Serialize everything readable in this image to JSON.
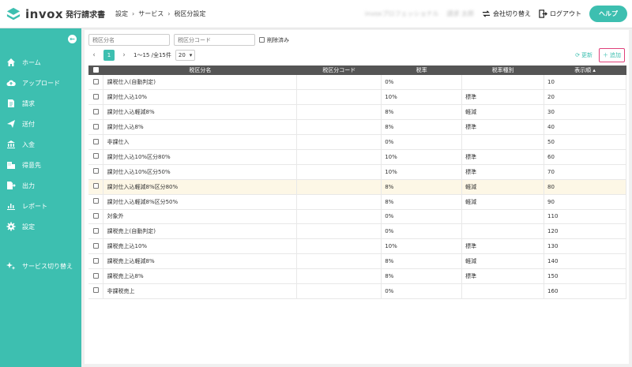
{
  "app": {
    "name": "invox",
    "product": "発行請求書"
  },
  "breadcrumb": [
    "設定",
    "サービス",
    "税区分設定"
  ],
  "header": {
    "company_blurred": "invoxプロフェッショナル",
    "user_blurred": "請求 太郎",
    "switch_company": "会社切り替え",
    "logout": "ログアウト",
    "help": "ヘルプ"
  },
  "sidebar": {
    "items": [
      {
        "label": "ホーム",
        "icon": "home-icon"
      },
      {
        "label": "アップロード",
        "icon": "cloud-upload-icon"
      },
      {
        "label": "請求",
        "icon": "document-icon"
      },
      {
        "label": "送付",
        "icon": "send-icon"
      },
      {
        "label": "入金",
        "icon": "bank-icon"
      },
      {
        "label": "得意先",
        "icon": "building-icon"
      },
      {
        "label": "出力",
        "icon": "export-icon"
      },
      {
        "label": "レポート",
        "icon": "chart-icon"
      },
      {
        "label": "設定",
        "icon": "gear-icon"
      }
    ],
    "switch_service": "サービス切り替え"
  },
  "filters": {
    "name_placeholder": "税区分名",
    "code_placeholder": "税区分コード",
    "show_deleted": "削除済み"
  },
  "pager": {
    "current": "1",
    "range": "1〜15 /全15件",
    "per_page": "20"
  },
  "actions": {
    "refresh": "更新",
    "add": "追加"
  },
  "table": {
    "columns": [
      "税区分名",
      "税区分コード",
      "税率",
      "税率種別",
      "表示順 ▴"
    ],
    "rows": [
      {
        "name": "課税仕入(自動判定)",
        "code": "",
        "rate": "0%",
        "type": "",
        "order": "10"
      },
      {
        "name": "課対仕入込10%",
        "code": "",
        "rate": "10%",
        "type": "標準",
        "order": "20"
      },
      {
        "name": "課対仕入込軽減8%",
        "code": "",
        "rate": "8%",
        "type": "軽減",
        "order": "30"
      },
      {
        "name": "課対仕入込8%",
        "code": "",
        "rate": "8%",
        "type": "標準",
        "order": "40"
      },
      {
        "name": "非課仕入",
        "code": "",
        "rate": "0%",
        "type": "",
        "order": "50"
      },
      {
        "name": "課対仕入込10%区分80%",
        "code": "",
        "rate": "10%",
        "type": "標準",
        "order": "60"
      },
      {
        "name": "課対仕入込10%区分50%",
        "code": "",
        "rate": "10%",
        "type": "標準",
        "order": "70"
      },
      {
        "name": "課対仕入込軽減8%区分80%",
        "code": "",
        "rate": "8%",
        "type": "軽減",
        "order": "80"
      },
      {
        "name": "課対仕入込軽減8%区分50%",
        "code": "",
        "rate": "8%",
        "type": "軽減",
        "order": "90"
      },
      {
        "name": "対象外",
        "code": "",
        "rate": "0%",
        "type": "",
        "order": "110"
      },
      {
        "name": "課税売上(自動判定)",
        "code": "",
        "rate": "0%",
        "type": "",
        "order": "120"
      },
      {
        "name": "課税売上込10%",
        "code": "",
        "rate": "10%",
        "type": "標準",
        "order": "130"
      },
      {
        "name": "課税売上込軽減8%",
        "code": "",
        "rate": "8%",
        "type": "軽減",
        "order": "140"
      },
      {
        "name": "課税売上込8%",
        "code": "",
        "rate": "8%",
        "type": "標準",
        "order": "150"
      },
      {
        "name": "非課税売上",
        "code": "",
        "rate": "0%",
        "type": "",
        "order": "160"
      }
    ]
  },
  "colors": {
    "accent": "#3dbfb0",
    "header_bg": "#555555",
    "highlight_row": "#fdf7e6",
    "add_border": "#e0407a"
  }
}
